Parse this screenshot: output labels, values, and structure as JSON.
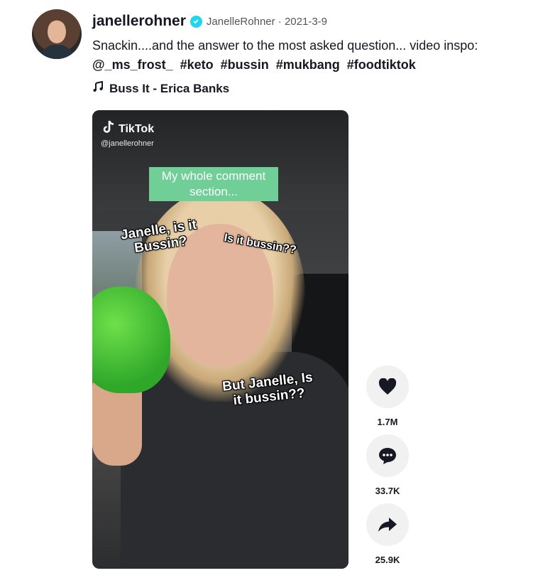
{
  "author": {
    "unique_id": "janellerohner",
    "nickname": "JanelleRohner",
    "date": "2021-3-9",
    "nickname_date_separator": " · "
  },
  "description": "Snackin....and the answer to the most asked question... video inspo:",
  "tags": [
    "@_ms_frost_",
    "#keto",
    "#bussin",
    "#mukbang",
    "#foodtiktok"
  ],
  "music": "Buss It - Erica Banks",
  "video": {
    "watermark_logo": "TikTok",
    "watermark_handle": "@janellerohner",
    "caption_box": "My whole comment section...",
    "overlay_texts": [
      "Janelle, is it Bussin?",
      "Is it bussin??",
      "But Janelle, Is it bussin??"
    ]
  },
  "actions": [
    {
      "name": "like",
      "icon": "heart-icon",
      "count": "1.7M"
    },
    {
      "name": "comment",
      "icon": "comment-icon",
      "count": "33.7K"
    },
    {
      "name": "share",
      "icon": "share-icon",
      "count": "25.9K"
    }
  ],
  "colors": {
    "verified": "#20d5ec",
    "caption_box": "#6fcf97",
    "text": "#161823"
  }
}
